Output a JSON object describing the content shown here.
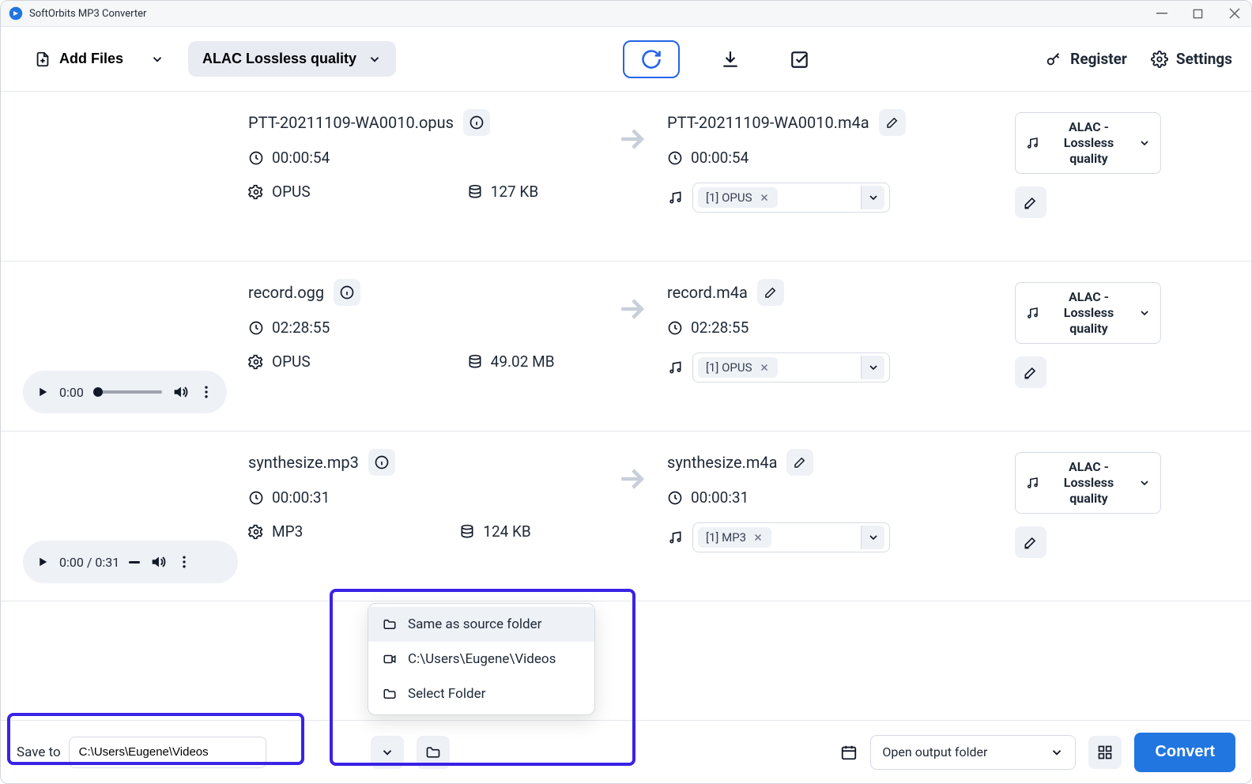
{
  "title": "SoftOrbits MP3 Converter",
  "toolbar": {
    "add_files": "Add Files",
    "quality_selector": "ALAC Lossless quality",
    "register": "Register",
    "settings": "Settings"
  },
  "rows": [
    {
      "src_name": "PTT-20211109-WA0010.opus",
      "src_dur": "00:00:54",
      "src_codec": "OPUS",
      "src_size": "127 KB",
      "dst_name": "PTT-20211109-WA0010.m4a",
      "dst_dur": "00:00:54",
      "track_tag": "[1] OPUS",
      "quality": "ALAC - Lossless quality",
      "player": null
    },
    {
      "src_name": "record.ogg",
      "src_dur": "02:28:55",
      "src_codec": "OPUS",
      "src_size": "49.02 MB",
      "dst_name": "record.m4a",
      "dst_dur": "02:28:55",
      "track_tag": "[1] OPUS",
      "quality": "ALAC - Lossless quality",
      "player": {
        "time": "0:00",
        "has_bar": true
      }
    },
    {
      "src_name": "synthesize.mp3",
      "src_dur": "00:00:31",
      "src_codec": "MP3",
      "src_size": "124 KB",
      "dst_name": "synthesize.m4a",
      "dst_dur": "00:00:31",
      "track_tag": "[1] MP3",
      "quality": "ALAC - Lossless quality",
      "player": {
        "time": "0:00 / 0:31",
        "has_bar": false
      }
    }
  ],
  "popup": {
    "items": [
      {
        "icon": "folder",
        "label": "Same as source folder",
        "selected": true
      },
      {
        "icon": "video",
        "label": "C:\\Users\\Eugene\\Videos",
        "selected": false
      },
      {
        "icon": "folder",
        "label": "Select Folder",
        "selected": false
      }
    ]
  },
  "footer": {
    "save_to_label": "Save to",
    "save_to_value": "C:\\Users\\Eugene\\Videos",
    "open_output": "Open output folder",
    "convert": "Convert"
  }
}
